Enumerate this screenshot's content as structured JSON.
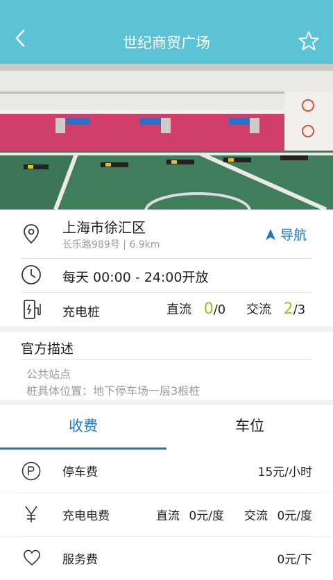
{
  "header": {
    "title": "世纪商贸广场"
  },
  "location": {
    "district": "上海市徐汇区",
    "address": "长乐路989号 | 6.9km",
    "nav_label": "导航"
  },
  "hours": {
    "text": "每天 00:00 - 24:00开放"
  },
  "charger": {
    "label": "充电桩",
    "dc_label": "直流",
    "dc_avail": "0",
    "dc_total": "/0",
    "ac_label": "交流",
    "ac_avail": "2",
    "ac_total": "/3"
  },
  "description": {
    "title": "官方描述",
    "line1": "公共站点",
    "line2": "桩具体位置：地下停车场一层3根桩"
  },
  "tabs": [
    {
      "label": "收费"
    },
    {
      "label": "车位"
    }
  ],
  "fees": {
    "parking": {
      "label": "停车费",
      "value": "15元/小时"
    },
    "electricity": {
      "label": "充电电费",
      "dc_label": "直流",
      "dc_value": "0元/度",
      "ac_label": "交流",
      "ac_value": "0元/度"
    },
    "service": {
      "label": "服务费",
      "value": "0元/下"
    }
  },
  "colors": {
    "header": "#5cc2d6",
    "accent": "#1e78c8",
    "available": "#9bc21c"
  }
}
